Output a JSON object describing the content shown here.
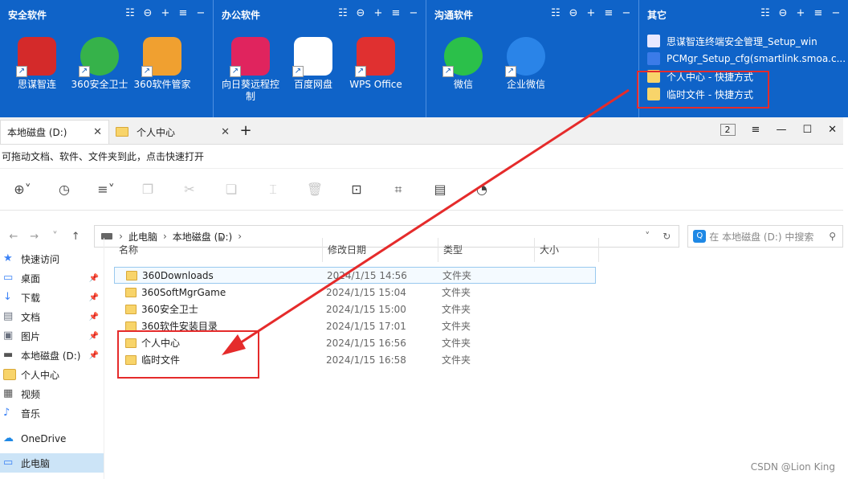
{
  "fences": [
    {
      "title": "安全软件",
      "apps": [
        {
          "label": "思谋智连",
          "icon": "sismo-icon",
          "color": "#d42a2a"
        },
        {
          "label": "360安全卫士",
          "icon": "360-safe-icon",
          "color": "#36b24a"
        },
        {
          "label": "360软件管家",
          "icon": "360-soft-icon",
          "color": "#f0a030"
        }
      ]
    },
    {
      "title": "办公软件",
      "apps": [
        {
          "label": "向日葵远程控制",
          "icon": "sunflower-icon",
          "color": "#e0245e"
        },
        {
          "label": "百度网盘",
          "icon": "baidu-pan-icon",
          "color": "#2b8ff0"
        },
        {
          "label": "WPS Office",
          "icon": "wps-icon",
          "color": "#e03030"
        }
      ]
    },
    {
      "title": "沟通软件",
      "apps": [
        {
          "label": "微信",
          "icon": "wechat-icon",
          "color": "#2bc04a"
        },
        {
          "label": "企业微信",
          "icon": "wecom-icon",
          "color": "#2a84e8"
        }
      ]
    },
    {
      "title": "其它",
      "items": [
        {
          "label": "思谋智连终端安全管理_Setup_win",
          "icon": "installer-icon"
        },
        {
          "label": "PCMgr_Setup_cfg(smartlink.smoa.c...",
          "icon": "pcmgr-icon"
        },
        {
          "label": "个人中心 - 快捷方式",
          "icon": "folder-shortcut-icon"
        },
        {
          "label": "临时文件 - 快捷方式",
          "icon": "folder-shortcut-icon"
        }
      ]
    }
  ],
  "explorer": {
    "tabs": [
      {
        "label": "本地磁盘 (D:)"
      },
      {
        "label": "个人中心"
      }
    ],
    "tab_count": "2",
    "hint": "可拖动文档、软件、文件夹到此，点击快速打开",
    "breadcrumb": [
      "此电脑",
      "本地磁盘 (D:)"
    ],
    "search_placeholder": "在 本地磁盘 (D:) 中搜索",
    "columns": {
      "name": "名称",
      "date": "修改日期",
      "type": "类型",
      "size": "大小"
    },
    "nav": [
      {
        "label": "快速访问",
        "icon": "star-icon",
        "pinned": false
      },
      {
        "label": "桌面",
        "icon": "desktop-icon",
        "pinned": true
      },
      {
        "label": "下载",
        "icon": "download-icon",
        "pinned": true
      },
      {
        "label": "文档",
        "icon": "document-icon",
        "pinned": true
      },
      {
        "label": "图片",
        "icon": "picture-icon",
        "pinned": true
      },
      {
        "label": "本地磁盘 (D:)",
        "icon": "drive-icon",
        "pinned": true
      },
      {
        "label": "个人中心",
        "icon": "folder-icon",
        "pinned": false
      },
      {
        "label": "视频",
        "icon": "video-icon",
        "pinned": false
      },
      {
        "label": "音乐",
        "icon": "music-icon",
        "pinned": false
      },
      {
        "label": "OneDrive",
        "icon": "cloud-icon",
        "pinned": false
      },
      {
        "label": "此电脑",
        "icon": "computer-icon",
        "pinned": false
      }
    ],
    "files": [
      {
        "name": "360Downloads",
        "date": "2024/1/15 14:56",
        "type": "文件夹"
      },
      {
        "name": "360SoftMgrGame",
        "date": "2024/1/15 15:04",
        "type": "文件夹"
      },
      {
        "name": "360安全卫士",
        "date": "2024/1/15 15:00",
        "type": "文件夹"
      },
      {
        "name": "360软件安装目录",
        "date": "2024/1/15 17:01",
        "type": "文件夹"
      },
      {
        "name": "个人中心",
        "date": "2024/1/15 16:56",
        "type": "文件夹"
      },
      {
        "name": "临时文件",
        "date": "2024/1/15 16:58",
        "type": "文件夹"
      }
    ]
  },
  "watermark": "CSDN @Lion King",
  "colors": {
    "fence_bg": "#0f63c8",
    "annotation": "#e52b2b",
    "selection": "#cce4f7"
  }
}
